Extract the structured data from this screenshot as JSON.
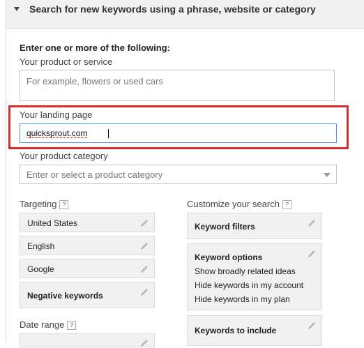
{
  "header": {
    "title": "Search for new keywords using a phrase, website or category"
  },
  "form": {
    "intro": "Enter one or more of the following:",
    "product_label": "Your product or service",
    "product_placeholder": "For example, flowers or used cars",
    "landing_label": "Your landing page",
    "landing_value": "quicksprout.com",
    "category_label": "Your product category",
    "category_placeholder": "Enter or select a product category"
  },
  "targeting": {
    "label": "Targeting",
    "help": "?",
    "items": [
      "United States",
      "English",
      "Google",
      "Negative keywords"
    ]
  },
  "date_range": {
    "label": "Date range",
    "help": "?"
  },
  "customize": {
    "label": "Customize your search",
    "help": "?",
    "keyword_filters": "Keyword filters",
    "keyword_options": {
      "title": "Keyword options",
      "items": [
        "Show broadly related ideas",
        "Hide keywords in my account",
        "Hide keywords in my plan"
      ]
    },
    "keywords_to_include": "Keywords to include"
  },
  "colors": {
    "highlight": "#d62f2f",
    "focus": "#4d90fe"
  }
}
